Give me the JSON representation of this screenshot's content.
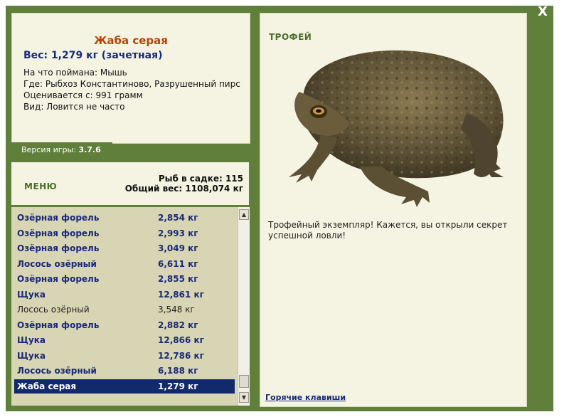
{
  "close_label": "X",
  "fish": {
    "title": "Жаба серая",
    "weight_line": "Вес: 1,279 кг (зачетная)",
    "bait": "На что поймана: Мышь",
    "location": "Где: Рыбхоз Константиново, Разрушенный пирс",
    "valued_from": "Оценивается с: 991 грамм",
    "kind": "Вид: Ловится не часто"
  },
  "version": {
    "label": "Версия игры:",
    "value": "3.7.6"
  },
  "menu_label": "МЕНЮ",
  "stats": {
    "fish_in_cage": "Рыб в садке: 115",
    "total_weight": "Общий вес: 1108,074 кг"
  },
  "catch_list": [
    {
      "name": "Озёрная форель",
      "weight": "2,854 кг",
      "style": "bold"
    },
    {
      "name": "Озёрная форель",
      "weight": "2,993 кг",
      "style": "bold"
    },
    {
      "name": "Озёрная форель",
      "weight": "3,049 кг",
      "style": "bold"
    },
    {
      "name": "Лосось озёрный",
      "weight": "6,611 кг",
      "style": "bold"
    },
    {
      "name": "Озёрная форель",
      "weight": "2,855 кг",
      "style": "bold"
    },
    {
      "name": "Щука",
      "weight": "12,861 кг",
      "style": "bold"
    },
    {
      "name": "Лосось озёрный",
      "weight": "3,548 кг",
      "style": "normal"
    },
    {
      "name": "Озёрная форель",
      "weight": "2,882 кг",
      "style": "bold"
    },
    {
      "name": "Щука",
      "weight": "12,866 кг",
      "style": "bold"
    },
    {
      "name": "Щука",
      "weight": "12,786 кг",
      "style": "bold"
    },
    {
      "name": "Лосось озёрный",
      "weight": "6,188 кг",
      "style": "bold"
    },
    {
      "name": "Жаба серая",
      "weight": "1,279 кг",
      "style": "selected"
    }
  ],
  "trophy_label": "ТРОФЕЙ",
  "trophy_text": "Трофейный экземпляр! Кажется, вы открыли секрет успешной ловли!",
  "hotkeys_label": "Горячие клавиши",
  "colors": {
    "frame": "#5f7f3a",
    "panel": "#f5f4e3",
    "list_bg": "#d8d5b4",
    "title": "#b84208",
    "link_blue": "#1a2a77",
    "selected_bg": "#112a6a"
  },
  "icons": {
    "close": "close-icon",
    "scroll_up": "arrow-up-icon",
    "scroll_down": "arrow-down-icon"
  }
}
